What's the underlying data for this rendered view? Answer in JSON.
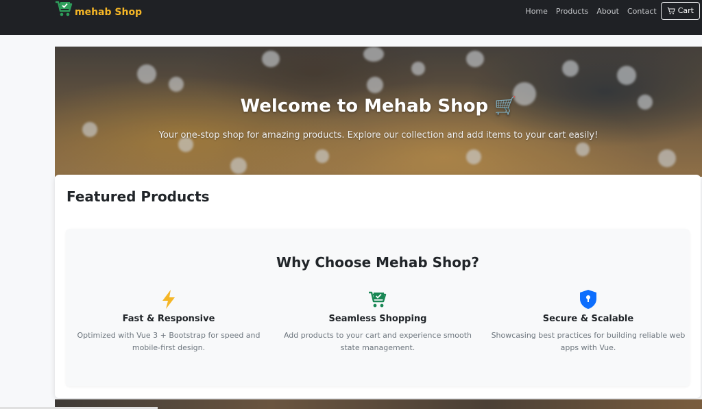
{
  "navbar": {
    "brand": "mehab Shop",
    "links": [
      "Home",
      "Products",
      "About",
      "Contact"
    ],
    "cart_label": "Cart"
  },
  "hero": {
    "title": "Welcome to Mehab Shop 🛒",
    "subtitle": "Your one-stop shop for amazing products. Explore our collection and add items to your cart easily!"
  },
  "featured": {
    "title": "Featured Products"
  },
  "why": {
    "title": "Why Choose Mehab Shop?",
    "features": [
      {
        "icon": "lightning-icon",
        "title": "Fast & Responsive",
        "desc": "Optimized with Vue 3 + Bootstrap for speed and mobile-first design."
      },
      {
        "icon": "cart-check-icon",
        "title": "Seamless Shopping",
        "desc": "Add products to your cart and experience smooth state management."
      },
      {
        "icon": "shield-lock-icon",
        "title": "Secure & Scalable",
        "desc": "Showcasing best practices for building reliable web apps with Vue."
      }
    ]
  },
  "colors": {
    "navbar_bg": "#1f2125",
    "brand": "#f5b626",
    "brand_icon": "#2e9e5b",
    "lightning": "#f5b626",
    "cart_check": "#198754",
    "shield": "#0d6efd"
  }
}
